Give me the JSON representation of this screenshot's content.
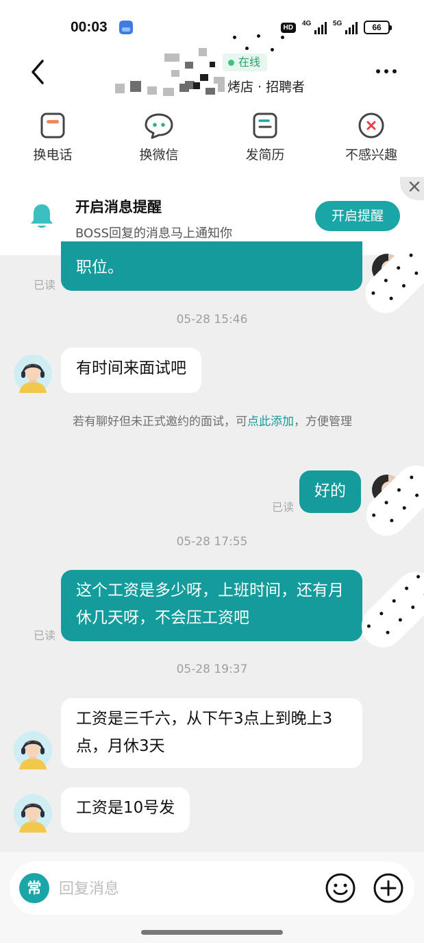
{
  "status_bar": {
    "time": "00:03",
    "hd": "HD",
    "net1": "4G",
    "net2": "5G",
    "battery": "66"
  },
  "header": {
    "online_label": "在线",
    "subtitle": "烤店 · 招聘者",
    "back_icon": "chevron-left-icon",
    "more_icon": "more-horizontal-icon"
  },
  "actions": [
    {
      "label": "换电话",
      "icon": "phone-exchange-icon"
    },
    {
      "label": "换微信",
      "icon": "wechat-icon"
    },
    {
      "label": "发简历",
      "icon": "resume-icon"
    },
    {
      "label": "不感兴趣",
      "icon": "not-interested-icon"
    }
  ],
  "notification": {
    "title": "开启消息提醒",
    "subtitle": "BOSS回复的消息马上通知你",
    "button": "开启提醒",
    "close_icon": "close-icon"
  },
  "messages": {
    "m1_text": "职位。",
    "read_label": "已读",
    "ts1": "05-28 15:46",
    "m2_text": "有时间来面试吧",
    "sys_prefix": "若有聊好但未正式邀约的面试，可",
    "sys_link": "点此添加",
    "sys_suffix": "，方便管理",
    "m3_text": "好的",
    "ts2": "05-28 17:55",
    "m4_text": "这个工资是多少呀，上班时间，还有月休几天呀，不会压工资吧",
    "ts3": "05-28 19:37",
    "m5_text": "工资是三千六，从下午3点上到晚上3点，月休3天",
    "m6_text": "工资是10号发"
  },
  "input_bar": {
    "quick_label": "常",
    "placeholder": "回复消息",
    "emoji_icon": "emoji-icon",
    "plus_icon": "plus-circle-icon"
  },
  "colors": {
    "accent": "#149b9b",
    "online_green": "#21a56b",
    "background": "#efefef"
  }
}
